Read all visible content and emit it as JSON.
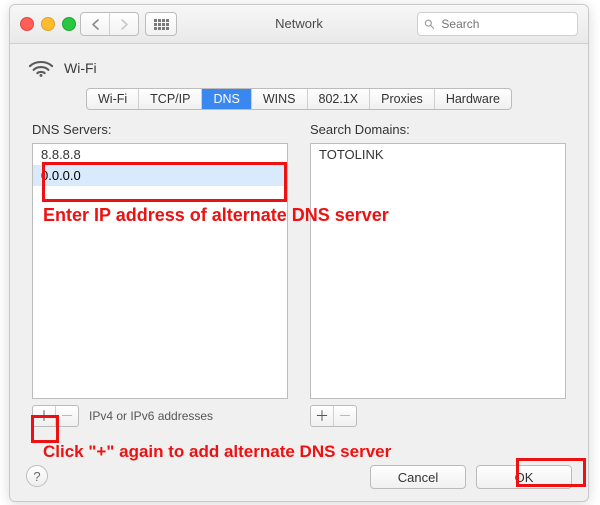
{
  "window": {
    "title": "Network",
    "search_placeholder": "Search"
  },
  "header": {
    "connection": "Wi-Fi"
  },
  "tabs": [
    "Wi-Fi",
    "TCP/IP",
    "DNS",
    "WINS",
    "802.1X",
    "Proxies",
    "Hardware"
  ],
  "active_tab_index": 2,
  "dns": {
    "servers_label": "DNS Servers:",
    "servers": [
      "8.8.8.8",
      "0.0.0.0"
    ],
    "editing_index": 1,
    "hint": "IPv4 or IPv6 addresses",
    "domains_label": "Search Domains:",
    "domains": [
      "TOTOLINK"
    ]
  },
  "footer": {
    "cancel": "Cancel",
    "ok": "OK"
  },
  "annotations": {
    "text1": "Enter IP address of alternate DNS server",
    "text2": "Click \"+\" again to add alternate DNS server"
  }
}
